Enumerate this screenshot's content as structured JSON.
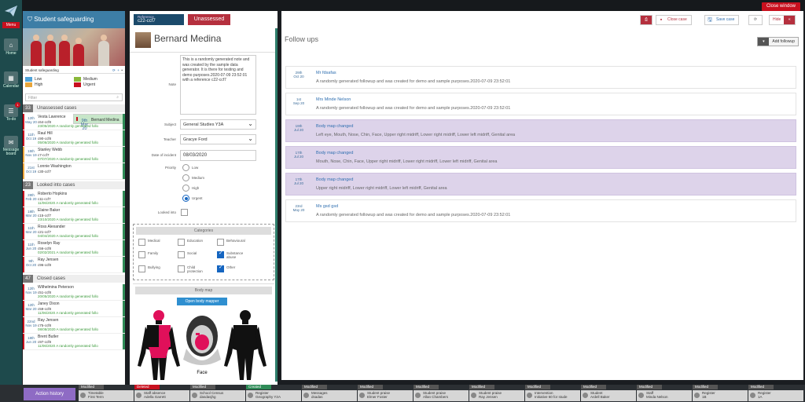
{
  "window": {
    "close_label": "Close window"
  },
  "nav": {
    "menu": "Menu",
    "items": [
      {
        "label": "Home",
        "icon": "home-icon"
      },
      {
        "label": "Calendar",
        "icon": "calendar-icon"
      },
      {
        "label": "To-do",
        "icon": "todo-icon",
        "badge": "1"
      },
      {
        "label": "Message board",
        "icon": "message-icon"
      }
    ]
  },
  "sidebar": {
    "title": "Student safeguarding",
    "tool_label": "Student safeguarding",
    "legend": {
      "low": "Low",
      "medium": "Medium",
      "high": "High",
      "urgent": "Urgent"
    },
    "filter_placeholder": "Filter",
    "sections": [
      {
        "count": "33",
        "label": "Unassessed cases",
        "cases": [
          {
            "day": "9th",
            "month": "Mar 20",
            "name": "Bernard Medina",
            "ref": "c22-ccf7",
            "desc": "09/08/2020 A randomly generated follo",
            "bar": "#c8101e",
            "selected": true
          },
          {
            "day": "12th",
            "month": "May 20",
            "name": "Vesta Lawrence",
            "ref": "c64-ccf8",
            "desc": "23/05/2020 A randomly generated follo",
            "bar": "#c8101e"
          },
          {
            "day": "11th",
            "month": "Oct 19",
            "name": "Raul Hill",
            "ref": "c90-ccf8",
            "desc": "05/06/2020 A randomly generated follo",
            "bar": "#c8101e"
          },
          {
            "day": "15th",
            "month": "Nov 19",
            "name": "Stanley Webb",
            "ref": "c7-ccf7",
            "desc": "07/07/2020 A randomly generated follo",
            "bar": "#e8a53a"
          },
          {
            "day": "21st",
            "month": "Oct 19",
            "name": "Lonnie Washington",
            "ref": "c30-ccf7",
            "desc": "",
            "bar": "#e8a53a"
          }
        ]
      },
      {
        "count": "23",
        "label": "Looked into cases",
        "cases": [
          {
            "day": "28th",
            "month": "Feb 20",
            "name": "Roberto Hopkins",
            "ref": "c11-ccf7",
            "desc": "11/06/2020 A randomly generated follo",
            "bar": "#c8101e"
          },
          {
            "day": "18th",
            "month": "Mar 20",
            "name": "Elaine Baker",
            "ref": "c15-ccf7",
            "desc": "23/10/2020 A randomly generated follo",
            "bar": "#c8101e"
          },
          {
            "day": "11th",
            "month": "Mar 20",
            "name": "Ross Alexander",
            "ref": "c21-ccf7",
            "desc": "04/04/2020 A randomly generated follo",
            "bar": "#c8101e"
          },
          {
            "day": "11th",
            "month": "Jun 20",
            "name": "Roselyn Ray",
            "ref": "c56-ccf8",
            "desc": "02/02/2021 A randomly generated follo",
            "bar": "#c8101e"
          },
          {
            "day": "9th",
            "month": "Oct 20",
            "name": "Ray Jensen",
            "ref": "c96-ccf8",
            "desc": "",
            "bar": "#c8101e"
          }
        ]
      },
      {
        "count": "47",
        "label": "Closed cases",
        "cases": [
          {
            "day": "12th",
            "month": "Nov 19",
            "name": "Wilhelmina Peterson",
            "ref": "c51-ccf8",
            "desc": "20/05/2020 A randomly generated follo",
            "bar": "#c8101e"
          },
          {
            "day": "12th",
            "month": "Mar 20",
            "name": "Janey Dixon",
            "ref": "c59-ccf8",
            "desc": "11/06/2020 A randomly generated follo",
            "bar": "#c8101e"
          },
          {
            "day": "22nd",
            "month": "Nov 19",
            "name": "Ray Jensen",
            "ref": "c75-ccf8",
            "desc": "08/08/2020 A randomly generated follo",
            "bar": "#c8101e"
          },
          {
            "day": "18th",
            "month": "Jun 20",
            "name": "Brent Butler",
            "ref": "c97-ccf8",
            "desc": "11/06/2020 A randomly generated follo",
            "bar": "#c8101e"
          }
        ]
      }
    ]
  },
  "detail": {
    "reference_label": "Reference",
    "reference": "c22-ccf7",
    "status": "Unassessed",
    "name": "Bernard Medina",
    "note_label": "Note",
    "note": "This is a randomly generated note and was created by the sample data generator. It is there for testing and demo purposes.2020-07-09 23:52:01 with a reference c22-ccf7",
    "subject_label": "Subject",
    "subject": "General Studies Y3A",
    "teacher_label": "Teacher",
    "teacher": "Gracye Ford",
    "date_label": "Date of incident",
    "date": "08/03/2020",
    "priority_label": "Priority",
    "priorities": [
      "Low",
      "Medium",
      "High",
      "Urgent"
    ],
    "looked_into_label": "Looked into",
    "categories_title": "Categories",
    "categories": [
      {
        "label": "Medical",
        "checked": false
      },
      {
        "label": "Education",
        "checked": false
      },
      {
        "label": "Behavioural",
        "checked": false
      },
      {
        "label": "Family",
        "checked": false
      },
      {
        "label": "Social",
        "checked": false
      },
      {
        "label": "Substance abuse",
        "checked": true
      },
      {
        "label": "Bullying",
        "checked": false
      },
      {
        "label": "Child protection",
        "checked": false
      },
      {
        "label": "Other",
        "checked": true
      }
    ],
    "bodymap_title": "Body map",
    "open_bodymap": "Open body mapper",
    "face_label": "Face"
  },
  "main": {
    "close_case": "Close case",
    "save_case": "Save case",
    "hide": "Hide",
    "title": "Follow ups",
    "add_followup": "Add followup",
    "followups": [
      {
        "day": "29th",
        "month": "Oct 20",
        "title": "Mr fdsafas",
        "text": "A randomly generated followup and was created for demo and sample purposes.2020-07-09 23:52:01",
        "purple": false
      },
      {
        "day": "1st",
        "month": "Sep 20",
        "title": "Mrs Minde Nelson",
        "text": "A randomly generated followup and was created for demo and sample purposes.2020-07-09 23:52:01",
        "purple": false
      },
      {
        "day": "19th",
        "month": "Jul 20",
        "title": "Body map changed",
        "text": "Left eye, Mouth, Nose, Chin, Face, Upper right midriff, Lower right midriff, Lower left midriff, Genital area",
        "purple": true
      },
      {
        "day": "17th",
        "month": "Jul 20",
        "title": "Body map changed",
        "text": "Mouth, Nose, Chin, Face, Upper right midriff, Lower right midriff, Lower left midriff, Genital area",
        "purple": true
      },
      {
        "day": "17th",
        "month": "Jul 20",
        "title": "Body map changed",
        "text": "Upper right midriff, Lower right midriff, Lower left midriff, Genital area",
        "purple": true
      },
      {
        "day": "23rd",
        "month": "May 20",
        "title": "Ms gsd gsd",
        "text": "A randomly generated followup and was created for demo and sample purposes.2020-07-09 23:52:01",
        "purple": false
      }
    ]
  },
  "bottom": {
    "action_history": "Action history",
    "items": [
      {
        "status": "Modified",
        "title": "Timetable",
        "sub": "First Term",
        "color": "#555"
      },
      {
        "status": "Deleted",
        "title": "Staff absence",
        "sub": "Adella Garrett",
        "color": "#c8101e"
      },
      {
        "status": "Modified",
        "title": "School Census",
        "sub": "dasdasjhg",
        "color": "#555"
      },
      {
        "status": "Created",
        "title": "Register",
        "sub": "Geography Y2A",
        "color": "#2e8b57"
      },
      {
        "status": "Modified",
        "title": "Messages",
        "sub": "dsadas",
        "color": "#555"
      },
      {
        "status": "Modified",
        "title": "Student praise",
        "sub": "Elmer Foster",
        "color": "#555"
      },
      {
        "status": "Modified",
        "title": "Student praise",
        "sub": "Allan Chambers",
        "color": "#555"
      },
      {
        "status": "Modified",
        "title": "Student praise",
        "sub": "Ray Jensen",
        "color": "#555"
      },
      {
        "status": "Modified",
        "title": "Intervention",
        "sub": "Initiative 60 for stude",
        "color": "#555"
      },
      {
        "status": "Modified",
        "title": "Student",
        "sub": "Ardell Baker",
        "color": "#555"
      },
      {
        "status": "Modified",
        "title": "Staff",
        "sub": "Minda Nelson",
        "color": "#555"
      },
      {
        "status": "Modified",
        "title": "Register",
        "sub": "1B",
        "color": "#555"
      },
      {
        "status": "Modified",
        "title": "Register",
        "sub": "1A",
        "color": "#555"
      }
    ]
  },
  "colors": {
    "low": "#4fa3d9",
    "medium": "#8ab83a",
    "high": "#e8a53a",
    "urgent": "#c8101e",
    "accent": "#b5303e"
  }
}
